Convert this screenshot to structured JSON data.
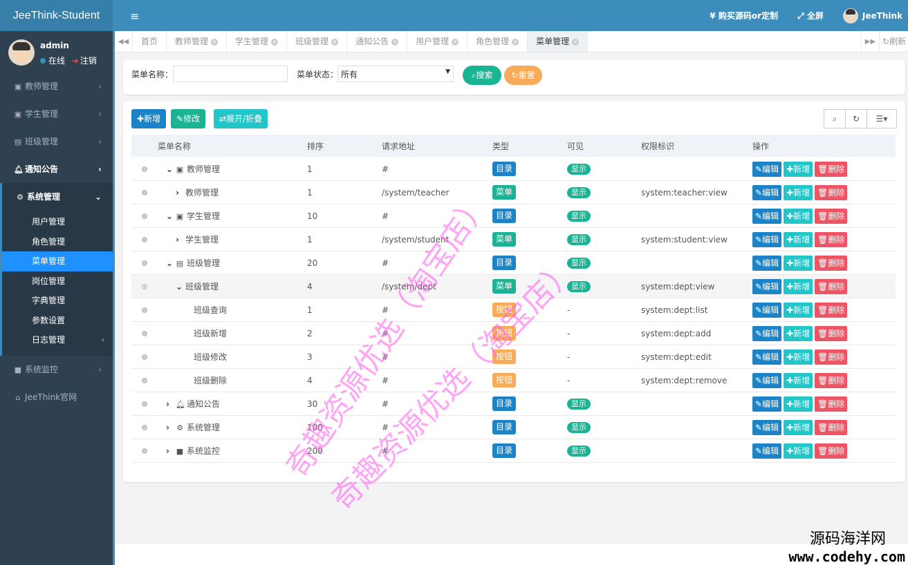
{
  "app": {
    "brand": "JeeThink-Student"
  },
  "user": {
    "name": "admin",
    "status": "在线",
    "logout": "注销"
  },
  "sidebar": {
    "items": [
      {
        "label": "教师管理",
        "icon": "id-card-icon"
      },
      {
        "label": "学生管理",
        "icon": "id-card-icon"
      },
      {
        "label": "班级管理",
        "icon": "address-card-icon"
      },
      {
        "label": "通知公告",
        "icon": "bell-icon"
      },
      {
        "label": "系统管理",
        "icon": "gear-icon"
      }
    ],
    "sub": [
      "用户管理",
      "角色管理",
      "菜单管理",
      "岗位管理",
      "字典管理",
      "参数设置",
      "日志管理"
    ],
    "bottom": [
      {
        "label": "系统监控",
        "icon": "video-icon"
      },
      {
        "label": "JeeThink官网",
        "icon": "home-icon"
      }
    ]
  },
  "topbar": {
    "buy": "¥ 购买源码or定制",
    "fullscreen": "全屏",
    "user": "JeeThink"
  },
  "tabs": [
    "首页",
    "教师管理",
    "学生管理",
    "班级管理",
    "通知公告",
    "用户管理",
    "角色管理",
    "菜单管理"
  ],
  "tabs_refresh": "刷新",
  "search": {
    "name_label": "菜单名称：",
    "name_value": "",
    "status_label": "菜单状态：",
    "status_value": "所有",
    "search_btn": "搜索",
    "reset_btn": "重置"
  },
  "toolbar": {
    "add": "新增",
    "edit": "修改",
    "expand": "展开/折叠"
  },
  "table": {
    "headers": [
      "菜单名称",
      "排序",
      "请求地址",
      "类型",
      "可见",
      "权限标识",
      "操作"
    ],
    "ops": {
      "edit": "编辑",
      "add": "新增",
      "del": "删除"
    },
    "rows": [
      {
        "name": "教师管理",
        "order": "1",
        "url": "#",
        "type": "目录",
        "visible": "显示",
        "perm": "",
        "level": 0,
        "tog": "open",
        "icon": "id-card-icon"
      },
      {
        "name": "教师管理",
        "order": "1",
        "url": "/system/teacher",
        "type": "菜单",
        "visible": "显示",
        "perm": "system:teacher:view",
        "level": 1,
        "tog": "closed",
        "icon": ""
      },
      {
        "name": "学生管理",
        "order": "10",
        "url": "#",
        "type": "目录",
        "visible": "显示",
        "perm": "",
        "level": 0,
        "tog": "open",
        "icon": "id-card-icon"
      },
      {
        "name": "学生管理",
        "order": "1",
        "url": "/system/student",
        "type": "菜单",
        "visible": "显示",
        "perm": "system:student:view",
        "level": 1,
        "tog": "closed",
        "icon": ""
      },
      {
        "name": "班级管理",
        "order": "20",
        "url": "#",
        "type": "目录",
        "visible": "显示",
        "perm": "",
        "level": 0,
        "tog": "open",
        "icon": "address-card-icon"
      },
      {
        "name": "班级管理",
        "order": "4",
        "url": "/system/dept",
        "type": "菜单",
        "visible": "显示",
        "perm": "system:dept:view",
        "level": 1,
        "tog": "open",
        "icon": "",
        "selected": true
      },
      {
        "name": "班级查询",
        "order": "1",
        "url": "#",
        "type": "按钮",
        "visible": "-",
        "perm": "system:dept:list",
        "level": 2,
        "tog": "",
        "icon": ""
      },
      {
        "name": "班级新增",
        "order": "2",
        "url": "#",
        "type": "按钮",
        "visible": "-",
        "perm": "system:dept:add",
        "level": 2,
        "tog": "",
        "icon": ""
      },
      {
        "name": "班级修改",
        "order": "3",
        "url": "#",
        "type": "按钮",
        "visible": "-",
        "perm": "system:dept:edit",
        "level": 2,
        "tog": "",
        "icon": ""
      },
      {
        "name": "班级删除",
        "order": "4",
        "url": "#",
        "type": "按钮",
        "visible": "-",
        "perm": "system:dept:remove",
        "level": 2,
        "tog": "",
        "icon": ""
      },
      {
        "name": "通知公告",
        "order": "30",
        "url": "#",
        "type": "目录",
        "visible": "显示",
        "perm": "",
        "level": 0,
        "tog": "closed",
        "icon": "bell-icon"
      },
      {
        "name": "系统管理",
        "order": "100",
        "url": "#",
        "type": "目录",
        "visible": "显示",
        "perm": "",
        "level": 0,
        "tog": "closed",
        "icon": "gear-icon"
      },
      {
        "name": "系统监控",
        "order": "200",
        "url": "#",
        "type": "目录",
        "visible": "显示",
        "perm": "",
        "level": 0,
        "tog": "closed",
        "icon": "video-icon"
      }
    ]
  },
  "watermark": {
    "line1": "奇趣资源优选（淘宝店）",
    "line2": "奇趣资源优选（淘宝店）"
  },
  "corner_logo": {
    "cn": "源码海洋网",
    "url": "www.codehy.com"
  },
  "colors": {
    "primary": "#3c8dbc",
    "sidebar": "#2f4050",
    "success": "#1ab394",
    "info": "#23c6c8",
    "warning": "#f8ac59",
    "danger": "#ed5565",
    "blue": "#1c84c6"
  }
}
